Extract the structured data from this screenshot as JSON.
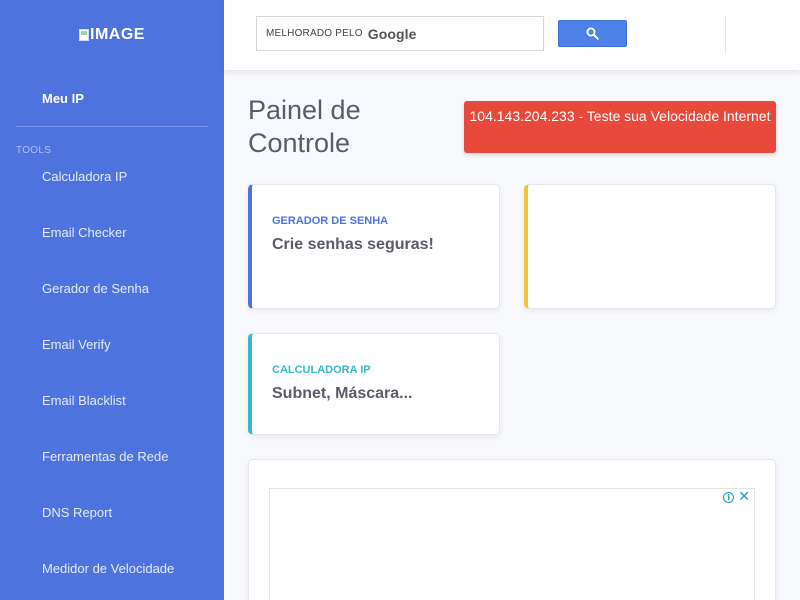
{
  "brand": {
    "alt_text": "IMAGE"
  },
  "sidebar": {
    "active_item": "Meu IP",
    "heading": "TOOLS",
    "items": [
      {
        "label": "Calculadora IP"
      },
      {
        "label": "Email Checker"
      },
      {
        "label": "Gerador de Senha"
      },
      {
        "label": "Email Verify"
      },
      {
        "label": "Email Blacklist"
      },
      {
        "label": "Ferramentas de Rede"
      },
      {
        "label": "DNS Report"
      },
      {
        "label": "Medidor de Velocidade"
      }
    ]
  },
  "search": {
    "prefix": "MELHORADO PELO",
    "brand": "Google",
    "button_icon": "search-icon"
  },
  "main": {
    "title": "Painel de Controle",
    "speed_button": "104.143.204.233 - Teste sua Velocidade Internet",
    "cards": [
      {
        "small": "GERADOR DE SENHA",
        "big": "Crie senhas seguras!",
        "accent": "#4e73df"
      },
      {
        "small": "",
        "big": "",
        "accent": "#f6c23e"
      },
      {
        "small": "CALCULADORA IP",
        "big": "Subnet, Máscara...",
        "accent": "#36b9cc"
      }
    ]
  },
  "ad": {
    "icons": [
      "info-icon",
      "close-icon"
    ]
  },
  "colors": {
    "sidebar": "#4e73df",
    "danger": "#e74a3b",
    "primary": "#4e73df",
    "warning": "#f6c23e",
    "info": "#36b9cc",
    "search_button": "#4f82e8"
  }
}
